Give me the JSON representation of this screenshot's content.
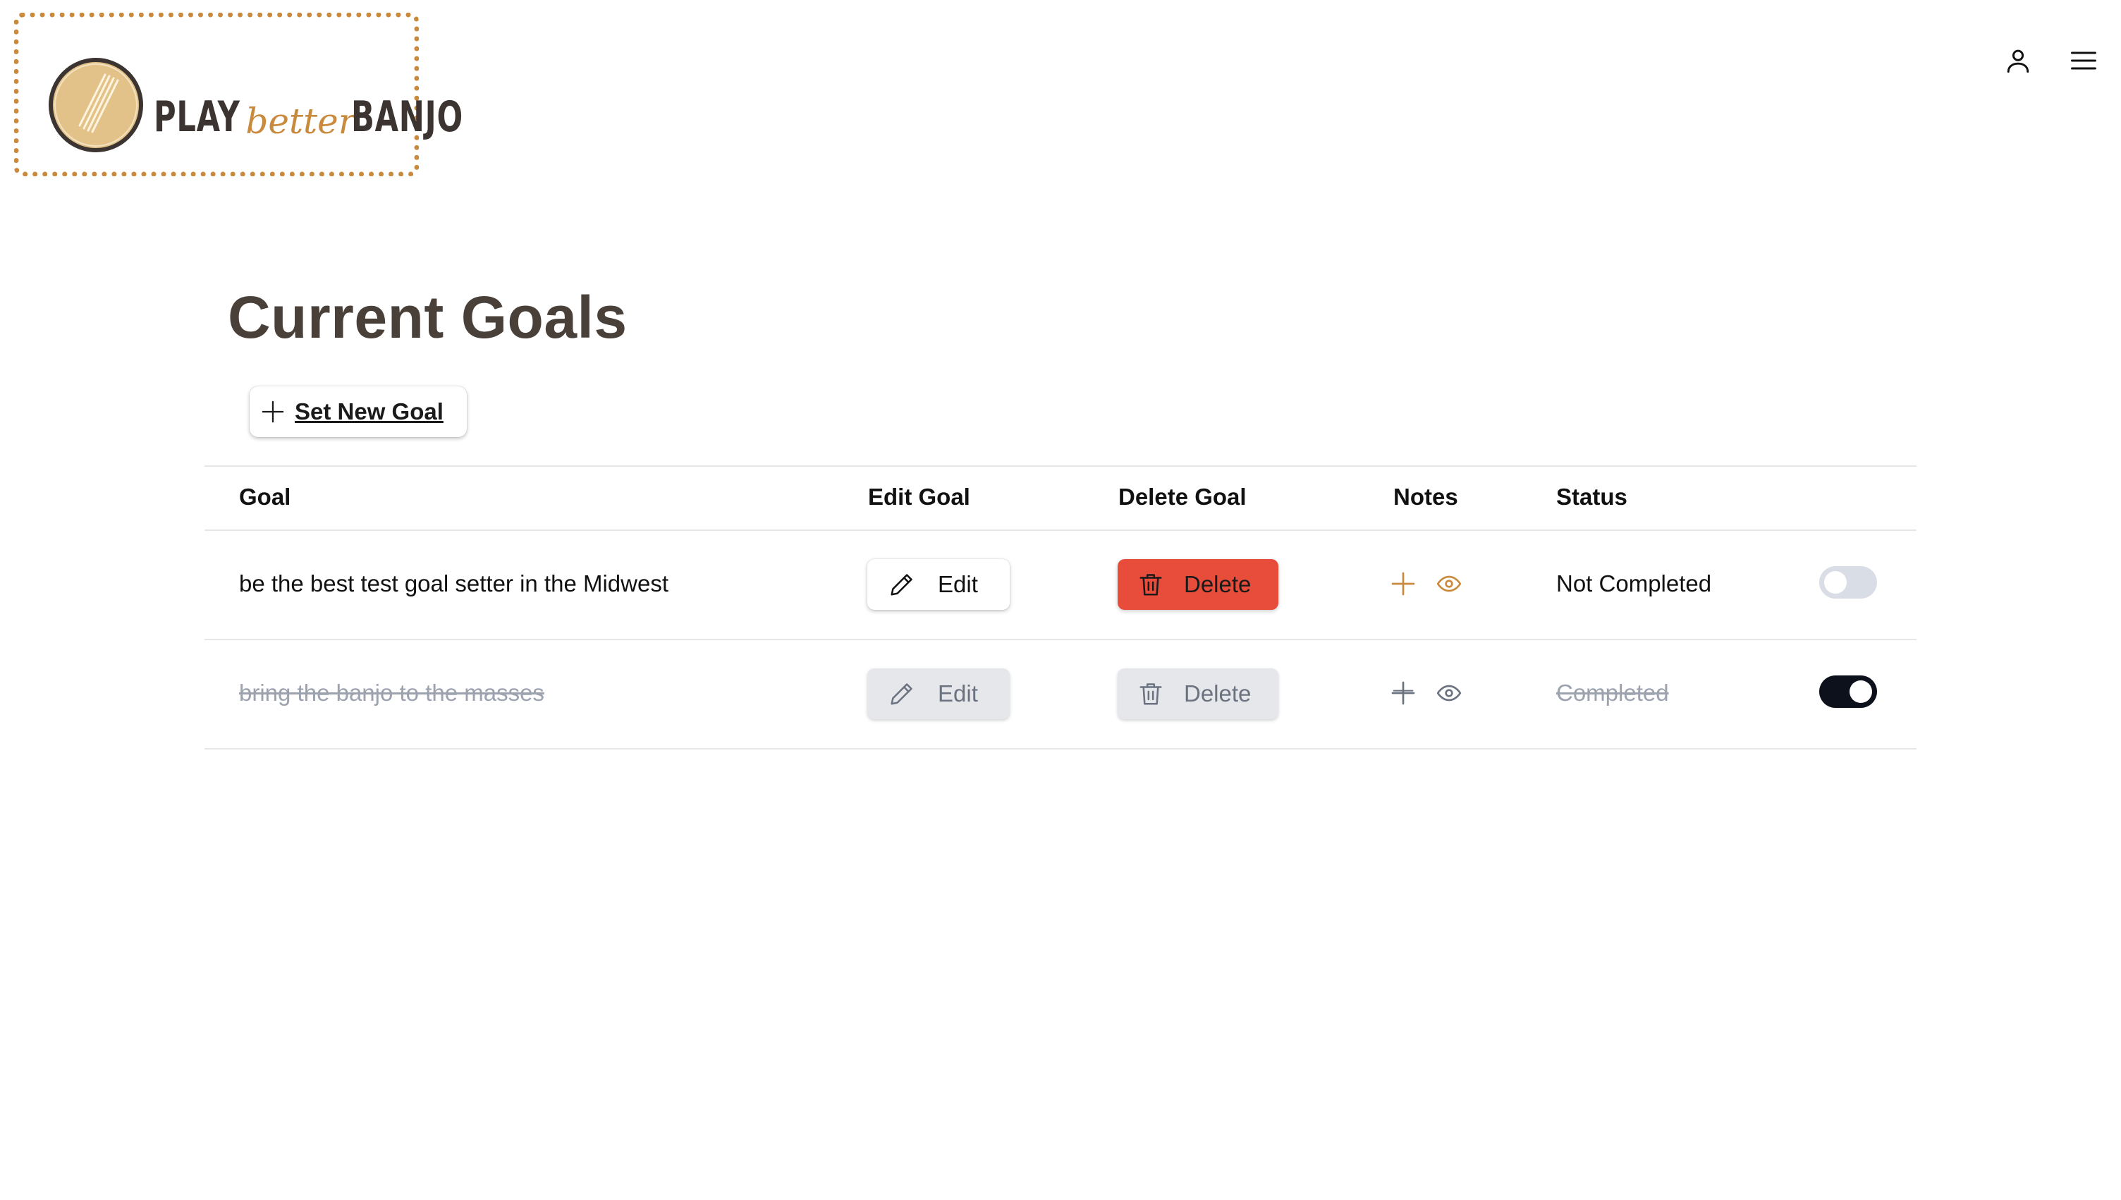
{
  "header": {
    "logo": {
      "word1": "PLAY",
      "word2": "better",
      "word3": "BANJO"
    },
    "icons": [
      "user-icon",
      "menu-icon"
    ]
  },
  "page": {
    "title": "Current Goals",
    "new_goal_label": "Set New Goal"
  },
  "table": {
    "columns": [
      "Goal",
      "Edit Goal",
      "Delete Goal",
      "Notes",
      "Status"
    ],
    "rows": [
      {
        "goal": "be the best test goal setter in the Midwest",
        "edit_label": "Edit",
        "delete_label": "Delete",
        "status": "Not Completed",
        "completed": false
      },
      {
        "goal": "bring the banjo to the masses",
        "edit_label": "Edit",
        "delete_label": "Delete",
        "status": "Completed",
        "completed": true
      }
    ]
  },
  "colors": {
    "accent": "#c98a3e",
    "danger": "#e84d3c",
    "title": "#4a403a",
    "toggle_on": "#0d111c",
    "toggle_off": "#d8dde6"
  }
}
